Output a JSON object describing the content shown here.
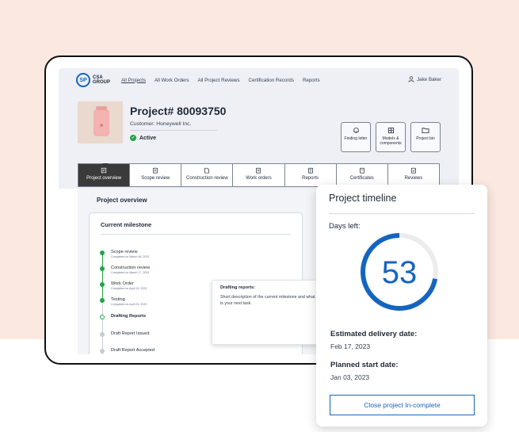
{
  "colors": {
    "accent": "#1565c0",
    "success": "#22a447",
    "background": "#fbe9e1"
  },
  "brand": {
    "logo_text_line1": "CSA",
    "logo_text_line2": "GROUP",
    "logo_mark": "SP"
  },
  "nav": {
    "links": [
      "All Projects",
      "All Work Orders",
      "All Project Reviews",
      "Certification Records",
      "Reports"
    ],
    "user": "Jake Baker"
  },
  "project": {
    "title": "Project# 80093750",
    "customer": "Customer: Honeywell Inc.",
    "status": "Active",
    "quick_actions": [
      {
        "label": "Finding letter",
        "icon": "bell-icon"
      },
      {
        "label": "Models & components",
        "icon": "grid-icon"
      },
      {
        "label": "Project bin",
        "icon": "folder-icon"
      }
    ]
  },
  "tabs": [
    "Project overview",
    "Scope review",
    "Construction review",
    "Work orders",
    "Reports",
    "Certificates",
    "Reviews"
  ],
  "overview": {
    "title": "Project overview",
    "milestone_title": "Current milestone",
    "milestones": [
      {
        "name": "Scope review",
        "date": "Completed on March 06, 2023"
      },
      {
        "name": "Construction review",
        "date": "Completed on March 17, 2023"
      },
      {
        "name": "Work Order",
        "date": "Completed on April 13, 2023"
      },
      {
        "name": "Testing",
        "date": "Completed on April 24, 2023"
      },
      {
        "name": "Drafting Reports",
        "date": ""
      },
      {
        "name": "Draft Report Issued",
        "date": ""
      },
      {
        "name": "Draft Report Accepted",
        "date": ""
      }
    ],
    "popup_title": "Drafting reports:",
    "popup_text": "Short description of the current milestone and what is your next task."
  },
  "timeline": {
    "title": "Project timeline",
    "days_label": "Days left:",
    "days_left": "53",
    "progress_fraction": 0.72,
    "delivery_label": "Estimated delivery date:",
    "delivery_value": "Feb 17, 2023",
    "start_label": "Planned start date:",
    "start_value": "Jan 03, 2023",
    "close_button": "Close project In-complete"
  }
}
